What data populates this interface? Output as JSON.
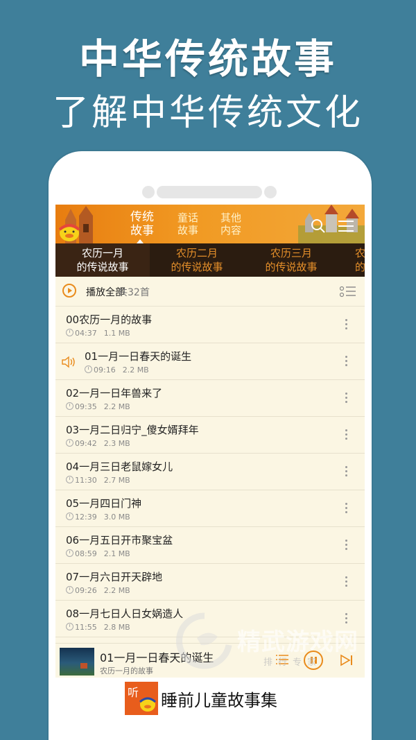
{
  "promo": {
    "headline": "中华传统故事",
    "subheadline": "了解中华传统文化"
  },
  "header": {
    "tabs": [
      {
        "line1": "传统",
        "line2": "故事"
      },
      {
        "line1": "童话",
        "line2": "故事"
      },
      {
        "line1": "其他",
        "line2": "内容"
      }
    ],
    "colors": {
      "accent": "#e98b1c",
      "header_bg": "#f19a23",
      "month_bar_bg": "#2b1c10"
    }
  },
  "month_tabs": [
    {
      "line1": "农历一月",
      "line2": "的传说故事"
    },
    {
      "line1": "农历二月",
      "line2": "的传说故事"
    },
    {
      "line1": "农历三月",
      "line2": "的传说故事"
    },
    {
      "line1": "农",
      "line2": "的"
    }
  ],
  "play_all": {
    "label": "播放全部",
    "count": "共32首"
  },
  "tracks": [
    {
      "title": "00农历一月的故事",
      "duration": "04:37",
      "size": "1.1 MB"
    },
    {
      "title": "01一月一日春天的诞生",
      "duration": "09:16",
      "size": "2.2 MB"
    },
    {
      "title": "02一月一日年兽来了",
      "duration": "09:35",
      "size": "2.2 MB"
    },
    {
      "title": "03一月二日归宁_傻女婿拜年",
      "duration": "09:42",
      "size": "2.3 MB"
    },
    {
      "title": "04一月三日老鼠嫁女儿",
      "duration": "11:30",
      "size": "2.7 MB"
    },
    {
      "title": "05一月四日门神",
      "duration": "12:39",
      "size": "3.0 MB"
    },
    {
      "title": "06一月五日开市聚宝盆",
      "duration": "08:59",
      "size": "2.1 MB"
    },
    {
      "title": "07一月六日开天辟地",
      "duration": "09:26",
      "size": "2.2 MB"
    },
    {
      "title": "08一月七日人日女娲造人",
      "duration": "11:55",
      "size": "2.8 MB"
    }
  ],
  "player": {
    "title": "01一月一日春天的诞生",
    "subtitle": "农历一月的故事"
  },
  "watermark": {
    "text": "精武游戏网",
    "sub": "排行专家"
  },
  "banner": {
    "logo_text": "听",
    "app_name": "睡前儿童故事集"
  }
}
